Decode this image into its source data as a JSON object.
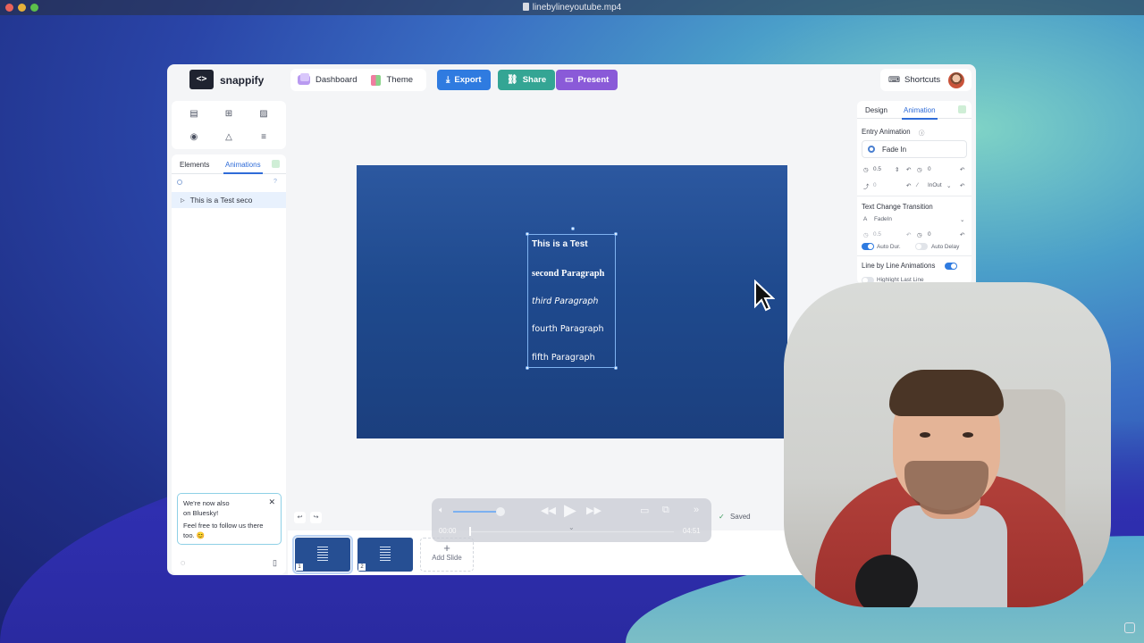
{
  "window": {
    "file_title": "linebylineyoutube.mp4"
  },
  "app": {
    "brand": "snappify",
    "logo_text": "<>"
  },
  "toolbar": {
    "dashboard_label": "Dashboard",
    "theme_label": "Theme",
    "export_label": "Export",
    "share_label": "Share",
    "present_label": "Present",
    "shortcuts_label": "Shortcuts"
  },
  "left_panel": {
    "tabs": [
      "Elements",
      "Animations"
    ],
    "active_tab": "Animations",
    "layer_item": "This is a Test seco"
  },
  "notice": {
    "title_line1": "We're now also",
    "title_line2": "on Bluesky!",
    "body_line1": "Feel free to follow us there",
    "body_line2": "too. 😊"
  },
  "slide": {
    "paragraphs": [
      "This is a Test",
      "second Paragraph",
      "third Paragraph",
      "fourth Paragraph",
      "fifth Paragraph"
    ]
  },
  "right_panel": {
    "tabs": [
      "Design",
      "Animation"
    ],
    "active_tab": "Animation",
    "entry_animation_label": "Entry Animation",
    "entry_animation_value": "Fade In",
    "entry_duration": "0.5",
    "entry_delay": "0",
    "entry_offset": "0",
    "entry_easing": "InOut",
    "text_change_label": "Text Change Transition",
    "text_change_value": "FadeIn",
    "text_change_duration": "0.5",
    "text_change_delay": "0",
    "auto_dur_label": "Auto Dur.",
    "auto_delay_label": "Auto Delay",
    "line_by_line_label": "Line by Line Animations",
    "highlight_last_line_label": "Highlight Last Line",
    "auto_dur_on": true,
    "auto_delay_on": false,
    "line_by_line_on": true
  },
  "status": {
    "saved_label": "Saved"
  },
  "slides": {
    "items": [
      {
        "number": "1"
      },
      {
        "number": "2"
      }
    ],
    "add_label": "Add Slide"
  },
  "video_player": {
    "current_time": "00:00",
    "end_time": "04:51"
  },
  "colors": {
    "export": "#2f7be0",
    "share": "#34a594",
    "present": "#8a5ad8",
    "accent": "#2f6cd8"
  }
}
